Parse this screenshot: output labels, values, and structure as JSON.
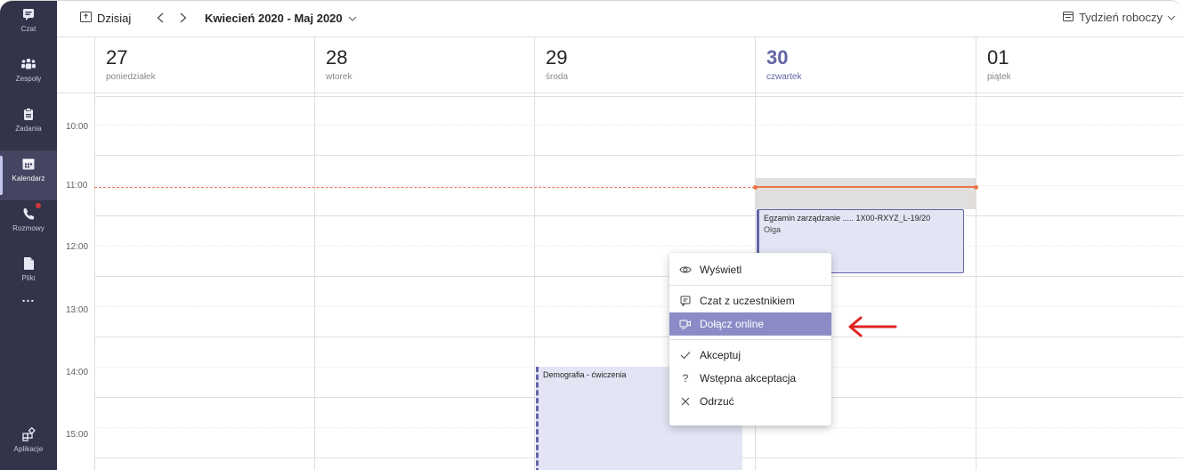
{
  "rail": {
    "items": [
      {
        "label": "Czat",
        "icon": "chat-icon"
      },
      {
        "label": "Zespoły",
        "icon": "teams-icon"
      },
      {
        "label": "Zadania",
        "icon": "assignments-icon"
      },
      {
        "label": "Kalendarz",
        "icon": "calendar-icon"
      },
      {
        "label": "Rozmowy",
        "icon": "calls-icon"
      },
      {
        "label": "Pliki",
        "icon": "files-icon"
      },
      {
        "label": "...",
        "icon": "more-icon"
      }
    ],
    "bottom_label": "Aplikacje"
  },
  "toolbar": {
    "today_label": "Dzisiaj",
    "range_label": "Kwiecień 2020 - Maj 2020",
    "view_label": "Tydzień roboczy"
  },
  "days": [
    {
      "num": "27",
      "name": "poniedziałek"
    },
    {
      "num": "28",
      "name": "wtorek"
    },
    {
      "num": "29",
      "name": "środa"
    },
    {
      "num": "30",
      "name": "czwartek"
    },
    {
      "num": "01",
      "name": "piątek"
    }
  ],
  "times": [
    "10:00",
    "11:00",
    "12:00",
    "13:00",
    "14:00",
    "15:00"
  ],
  "events": {
    "exam": {
      "title": "Egzamin zarządzanie ..... 1X00-RXYZ_L-19/20",
      "organizer": "Olga"
    },
    "demo": {
      "title": "Demografia - ćwiczenia"
    }
  },
  "context_menu": {
    "items": [
      {
        "label": "Wyświetl",
        "icon": "eye-icon"
      },
      {
        "label": "Czat z uczestnikiem",
        "icon": "chat-icon"
      },
      {
        "label": "Dołącz online",
        "icon": "join-meeting-icon"
      },
      {
        "label": "Akceptuj",
        "icon": "checkmark-icon"
      },
      {
        "label": "Wstępna akceptacja",
        "icon": "question-icon"
      },
      {
        "label": "Odrzuć",
        "icon": "close-icon"
      }
    ],
    "highlighted": "Dołącz online"
  },
  "colors": {
    "rail_bg": "#33344a",
    "accent": "#6264a7",
    "highlight": "#8b8cc7",
    "now_line": "#e97548",
    "annotation_arrow": "#e02424"
  }
}
